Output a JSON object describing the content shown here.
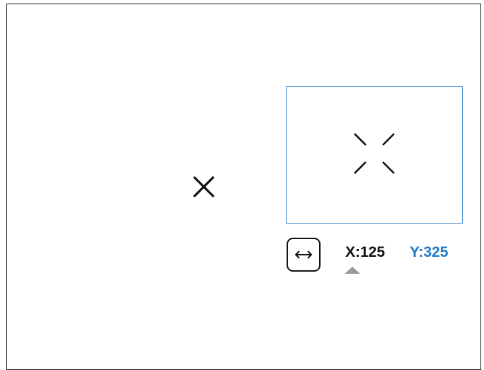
{
  "crosshair": {
    "icon": "x-crosshair-icon"
  },
  "zoom_window": {
    "icon": "bracket-reticle-icon",
    "border_color": "#3d8bd0"
  },
  "coordinates": {
    "toggle_icon": "horizontal-arrows-icon",
    "x_label": "X:125",
    "y_label": "Y:325",
    "x_color": "#111111",
    "y_color": "#1f78c8",
    "active_axis": "X",
    "active_indicator_color": "#9a9a9a"
  }
}
